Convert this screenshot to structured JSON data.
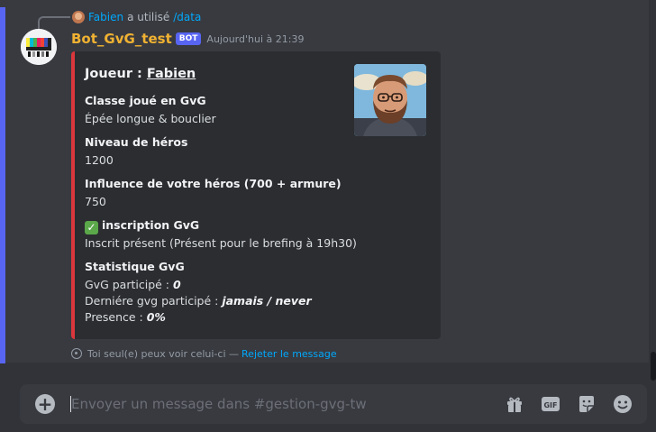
{
  "reply": {
    "user": "Fabien",
    "text": "a utilisé",
    "command": "/data"
  },
  "message": {
    "username": "Bot_GvG_test",
    "bot_tag": "BOT",
    "timestamp": "Aujourd'hui à 21:39"
  },
  "embed": {
    "title_prefix": "Joueur : ",
    "title_user": "Fabien",
    "border_color": "#da373c",
    "fields": [
      {
        "name": "Classe joué en GvG",
        "value": "Épée longue & bouclier"
      },
      {
        "name": "Niveau de héros",
        "value": "1200"
      },
      {
        "name": "Influence de votre héros (700 + armure)",
        "value": "750"
      },
      {
        "name_icon": "✓",
        "name": "inscription GvG",
        "value": "Inscrit présent (Présent pour le brefing à 19h30)"
      }
    ],
    "stats": {
      "name": "Statistique GvG",
      "lines": [
        {
          "label": "GvG participé : ",
          "value": "0"
        },
        {
          "label": "Derniére gvg participé : ",
          "value": "jamais / never"
        },
        {
          "label": "Presence : ",
          "value": "0%"
        }
      ]
    }
  },
  "ephemeral": {
    "text": "Toi seul(e) peux voir celui-ci —",
    "dismiss": "Rejeter le message"
  },
  "composer": {
    "placeholder": "Envoyer un message dans #gestion-gvg-tw",
    "add_icon": "+",
    "gif_label": "GIF"
  },
  "colors": {
    "accent": "#5865f2",
    "link": "#00a8fc",
    "username": "#f0b232"
  }
}
